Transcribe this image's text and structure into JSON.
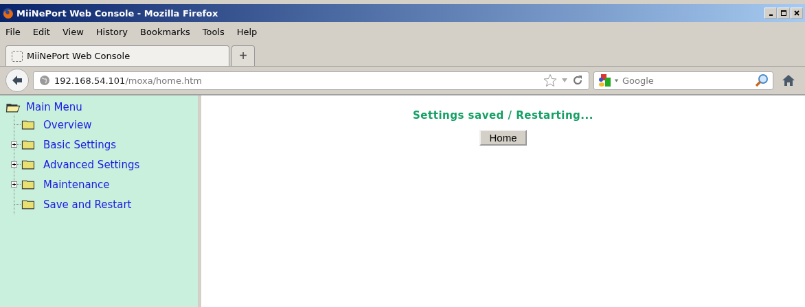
{
  "window": {
    "title": "MiiNePort Web Console - Mozilla Firefox"
  },
  "menu": [
    "File",
    "Edit",
    "View",
    "History",
    "Bookmarks",
    "Tools",
    "Help"
  ],
  "tabs": [
    {
      "label": "MiiNePort Web Console",
      "selected": true
    }
  ],
  "new_tab": "+",
  "address": {
    "host": "192.168.54.101",
    "path": "/moxa/home.htm"
  },
  "search": {
    "placeholder": "Google"
  },
  "sidebar": {
    "label": "Main Menu",
    "expanded": true,
    "children": [
      {
        "label": "Overview",
        "expandable": false
      },
      {
        "label": "Basic Settings",
        "expandable": true
      },
      {
        "label": "Advanced Settings",
        "expandable": true
      },
      {
        "label": "Maintenance",
        "expandable": true
      },
      {
        "label": "Save and Restart",
        "expandable": false
      }
    ]
  },
  "content": {
    "message": "Settings saved / Restarting...",
    "button": "Home"
  }
}
